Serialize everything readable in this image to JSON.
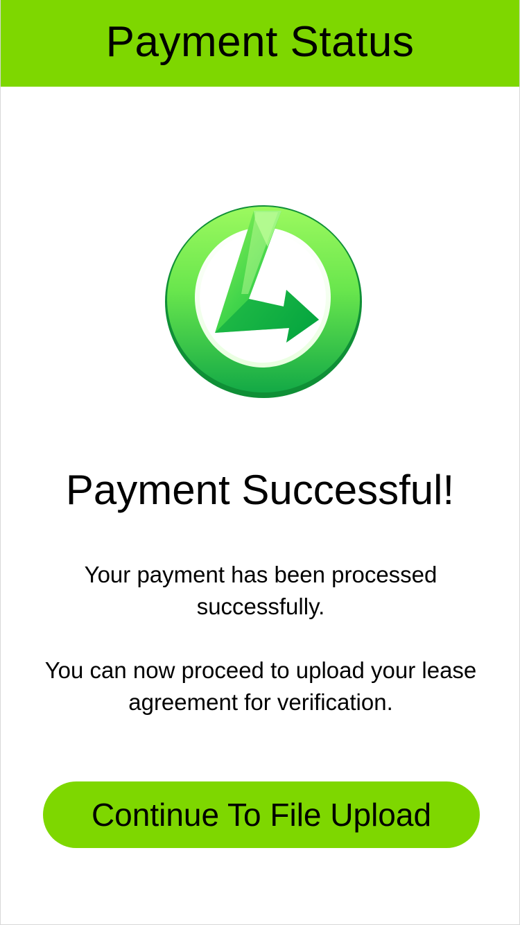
{
  "header": {
    "title": "Payment Status"
  },
  "logo": {
    "icon": "green-circle-l-arrow-logo"
  },
  "status": {
    "title": "Payment Successful!",
    "message_1": "Your payment has been processed successfully.",
    "message_2": "You can now proceed to upload your lease agreement for verification."
  },
  "actions": {
    "continue_label": "Continue To File Upload"
  },
  "colors": {
    "accent": "#7ed700",
    "text": "#000000",
    "background": "#ffffff"
  }
}
